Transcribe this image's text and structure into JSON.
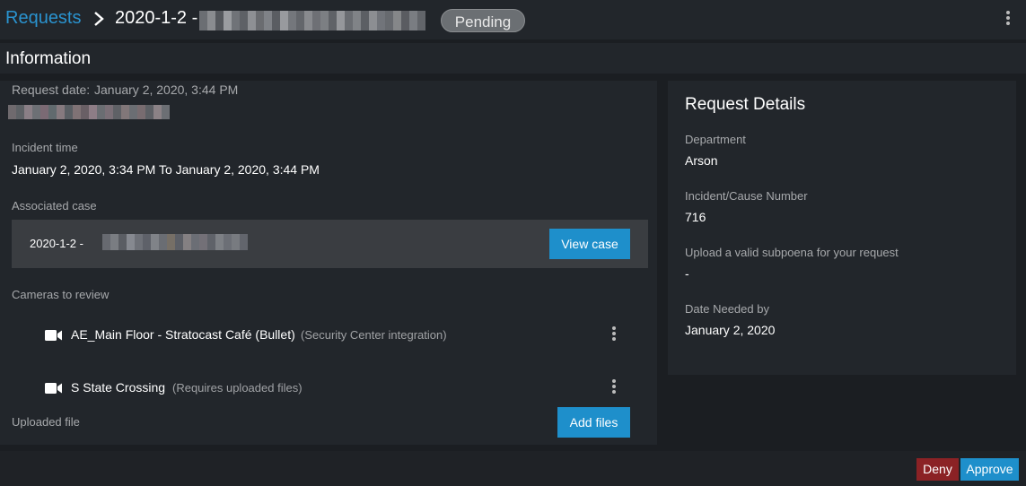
{
  "header": {
    "breadcrumb_link": "Requests",
    "title": "2020-1-2 -",
    "status": "Pending"
  },
  "section": {
    "title": "Information"
  },
  "info": {
    "request_date_label": "Request date:",
    "request_date_value": "January 2, 2020, 3:44 PM",
    "incident_time_label": "Incident time",
    "incident_time_value": "January 2, 2020, 3:34 PM To January 2, 2020, 3:44 PM",
    "associated_case_label": "Associated case",
    "associated_case_value": "2020-1-2 -",
    "view_case_label": "View case",
    "cameras_label": "Cameras to review",
    "cameras": [
      {
        "name": "AE_Main Floor - Stratocast Café (Bullet)",
        "note": "(Security Center integration)"
      },
      {
        "name": "S State Crossing",
        "note": "(Requires uploaded files)"
      }
    ],
    "uploaded_file_label": "Uploaded file",
    "add_files_label": "Add files"
  },
  "details": {
    "title": "Request Details",
    "department_label": "Department",
    "department_value": "Arson",
    "cause_number_label": "Incident/Cause Number",
    "cause_number_value": "716",
    "subpoena_label": "Upload a valid subpoena for your request",
    "subpoena_value": "-",
    "date_needed_label": "Date Needed by",
    "date_needed_value": "January 2, 2020"
  },
  "footer": {
    "deny_label": "Deny",
    "approve_label": "Approve"
  },
  "colors": {
    "accent": "#1e8fcb",
    "deny": "#8b2225",
    "background": "#1b1e22",
    "panel": "#22262b"
  },
  "icons": [
    "chevron-right-icon",
    "kebab-menu-icon",
    "video-camera-icon"
  ]
}
